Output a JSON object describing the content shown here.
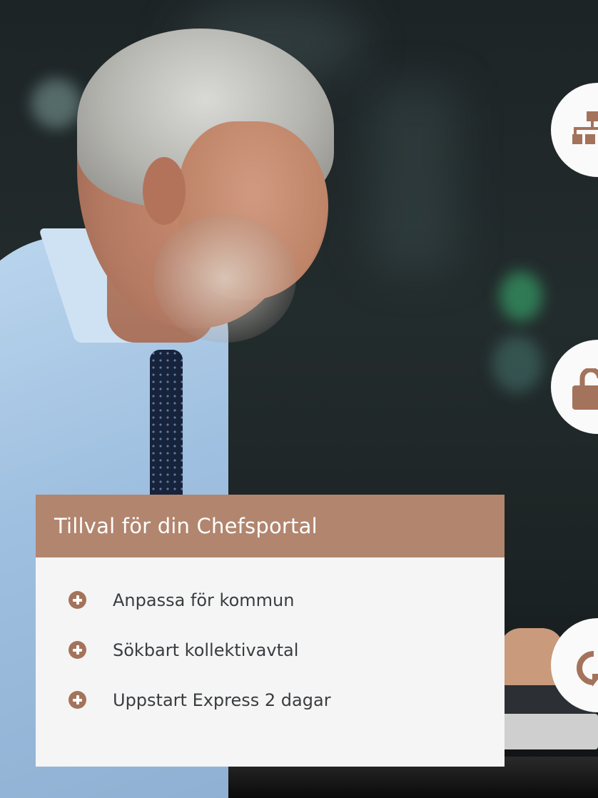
{
  "card": {
    "title": "Tillval för din Chefsportal",
    "options": [
      {
        "label": "Anpassa för kommun",
        "icon": "plus-circle-icon"
      },
      {
        "label": "Sökbart kollektivavtal",
        "icon": "plus-circle-icon"
      },
      {
        "label": "Uppstart Express 2 dagar",
        "icon": "plus-circle-icon"
      }
    ]
  },
  "feature_icons": [
    "sitemap-icon",
    "unlock-icon",
    "refresh-icon"
  ],
  "colors": {
    "accent": "#b2856e",
    "icon": "#a4735b",
    "card_background": "#f5f5f5",
    "text": "#3a3d40"
  }
}
